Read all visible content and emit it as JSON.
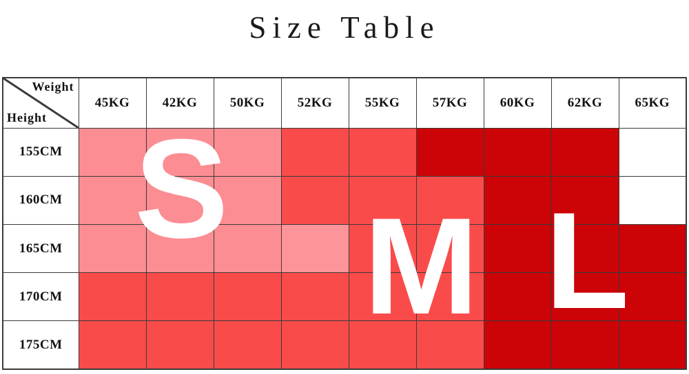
{
  "title": "Size Table",
  "table": {
    "corner": {
      "weight_label": "Weight",
      "height_label": "Height"
    },
    "column_headers": [
      "45KG",
      "42KG",
      "50KG",
      "52KG",
      "55KG",
      "57KG",
      "60KG",
      "62KG",
      "65KG"
    ],
    "row_headers": [
      "155CM",
      "160CM",
      "165CM",
      "170CM",
      "175CM"
    ],
    "cell_fills": [
      [
        "light",
        "light",
        "light",
        "medium",
        "medium",
        "dark",
        "dark",
        "dark",
        "white"
      ],
      [
        "light",
        "light",
        "light",
        "medium",
        "medium",
        "medium",
        "dark",
        "dark",
        "white"
      ],
      [
        "light",
        "light",
        "light",
        "light2",
        "medium",
        "medium",
        "dark",
        "dark",
        "dark"
      ],
      [
        "medium",
        "medium",
        "medium",
        "medium",
        "medium",
        "medium",
        "dark",
        "dark",
        "dark"
      ],
      [
        "medium",
        "medium",
        "medium",
        "medium",
        "medium",
        "medium",
        "dark",
        "dark",
        "dark"
      ]
    ]
  },
  "size_letters": [
    {
      "id": "letter-s",
      "text": "S"
    },
    {
      "id": "letter-m",
      "text": "M"
    },
    {
      "id": "letter-l",
      "text": "L"
    }
  ],
  "colors": {
    "light": "#fc8d93",
    "light2": "#fc9499",
    "medium": "#fa4b4b",
    "dark": "#cc0408",
    "white": "#ffffff",
    "border": "#3a3a3a",
    "text": "#111111",
    "letter": "#ffffff"
  }
}
